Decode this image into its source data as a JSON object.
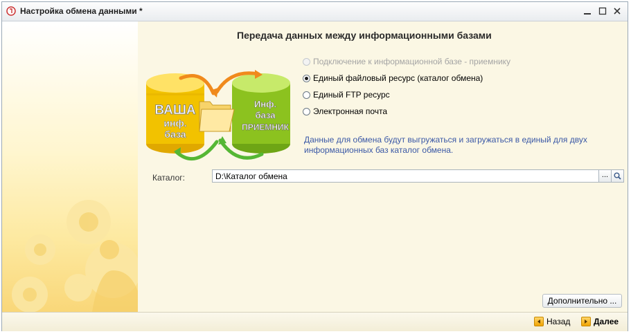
{
  "window": {
    "title": "Настройка обмена данными *",
    "app_icon": "1c-app-icon",
    "controls": [
      "minimize-icon",
      "maximize-icon",
      "close-icon"
    ]
  },
  "heading": "Передача данных между информационными базами",
  "illustration": {
    "left_db_lines": [
      "ВАША",
      "инф.",
      "база"
    ],
    "right_db_lines": [
      "Инф.",
      "база",
      "ПРИЕМНИК"
    ],
    "icons": [
      "database-icon",
      "folder-icon",
      "arrow-icon"
    ],
    "colors": {
      "left_db": "#f2c200",
      "right_db": "#8cc21f",
      "arrow_orange": "#f08a1c",
      "arrow_green": "#55b734"
    }
  },
  "options": [
    {
      "label": "Подключение к информационной базе - приемнику",
      "checked": false,
      "disabled": true
    },
    {
      "label": "Единый файловый ресурс (каталог обмена)",
      "checked": true,
      "disabled": false
    },
    {
      "label": "Единый FTP ресурс",
      "checked": false,
      "disabled": false
    },
    {
      "label": "Электронная почта",
      "checked": false,
      "disabled": false
    }
  ],
  "info_text": "Данные для обмена будут выгружаться и загружаться в единый для двух информационных баз каталог обмена.",
  "catalog": {
    "label": "Каталог:",
    "value": "D:\\Каталог обмена",
    "select_button": "...",
    "search_icon": "search-icon"
  },
  "more_button": "Дополнительно ...",
  "footer": {
    "back_label": "Назад",
    "next_label": "Далее"
  },
  "colors": {
    "info_text": "#3a58a6",
    "background": "#fbf7e4",
    "nav_arrow": "#f0a400"
  }
}
